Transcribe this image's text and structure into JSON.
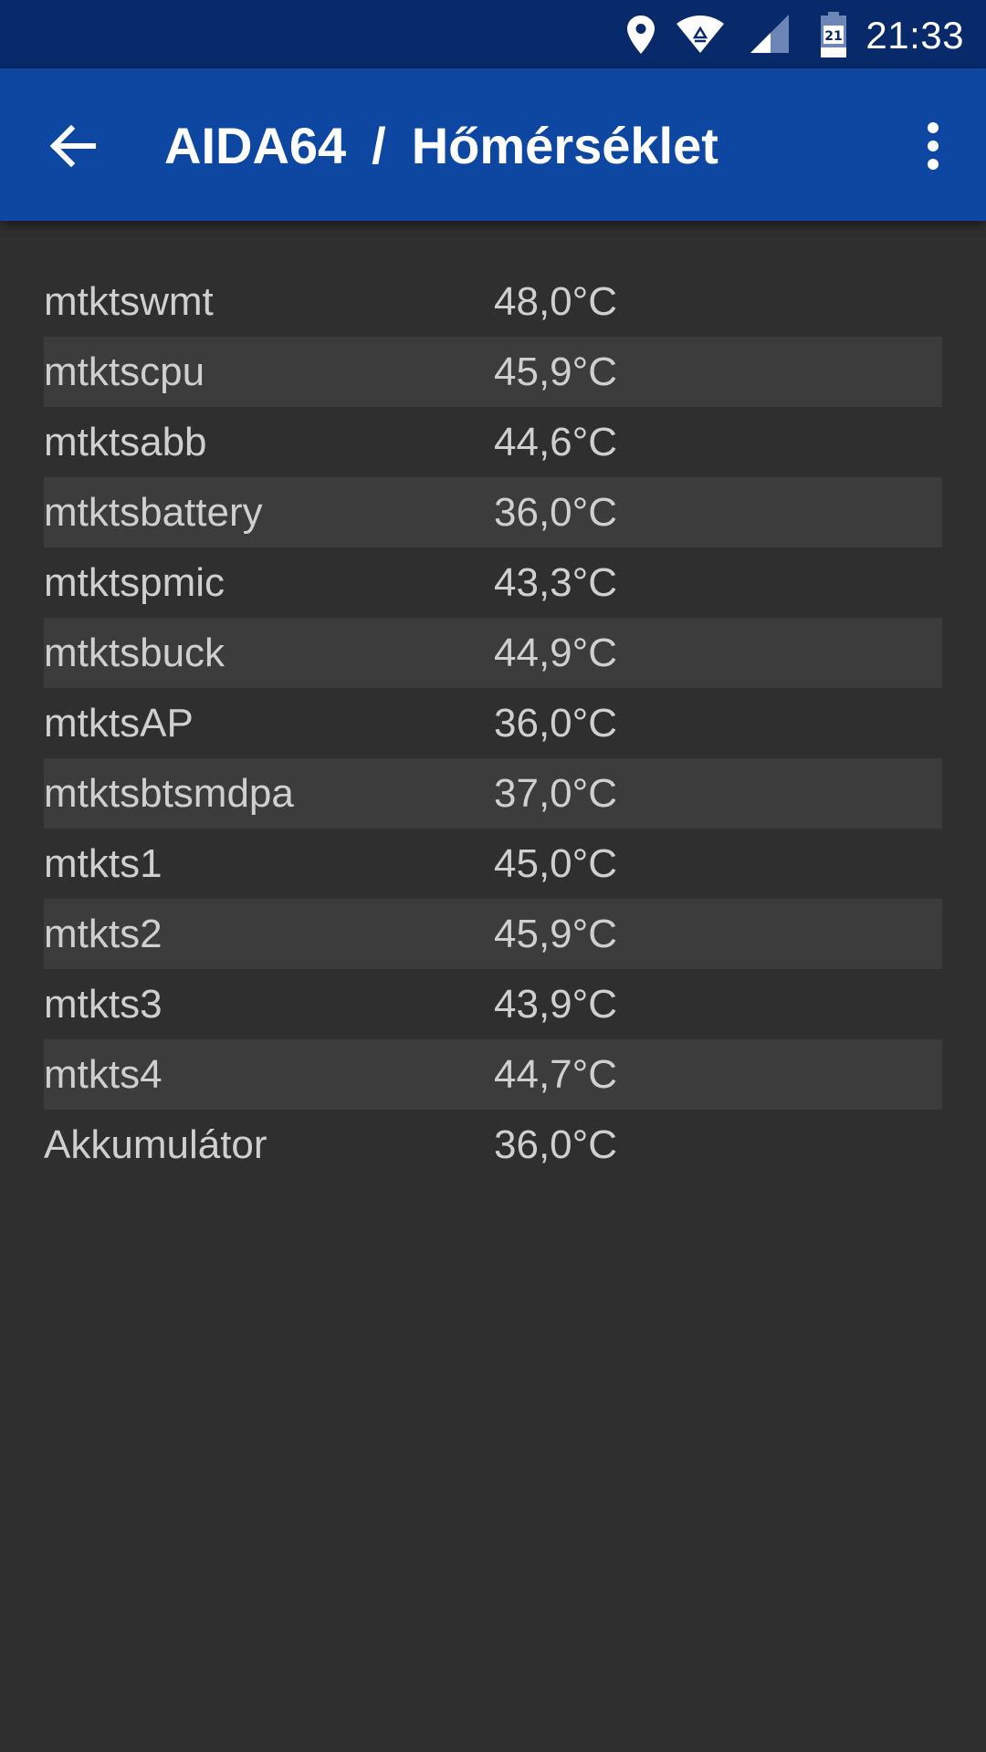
{
  "status_bar": {
    "time": "21:33",
    "battery_level_text": "21",
    "icons": [
      "location-icon",
      "wifi-icon",
      "cell-signal-icon",
      "battery-icon"
    ]
  },
  "app_bar": {
    "app_name": "AIDA64",
    "separator": "/",
    "page_title": "Hőmérséklet",
    "back_icon": "arrow-back-icon",
    "menu_icon": "more-vert-icon"
  },
  "sensors": [
    {
      "name": "mtktswmt",
      "value": "48,0°C"
    },
    {
      "name": "mtktscpu",
      "value": "45,9°C"
    },
    {
      "name": "mtktsabb",
      "value": "44,6°C"
    },
    {
      "name": "mtktsbattery",
      "value": "36,0°C"
    },
    {
      "name": "mtktspmic",
      "value": "43,3°C"
    },
    {
      "name": "mtktsbuck",
      "value": "44,9°C"
    },
    {
      "name": "mtktsAP",
      "value": "36,0°C"
    },
    {
      "name": "mtktsbtsmdpa",
      "value": "37,0°C"
    },
    {
      "name": "mtkts1",
      "value": "45,0°C"
    },
    {
      "name": "mtkts2",
      "value": "45,9°C"
    },
    {
      "name": "mtkts3",
      "value": "43,9°C"
    },
    {
      "name": "mtkts4",
      "value": "44,7°C"
    },
    {
      "name": "Akkumulátor",
      "value": "36,0°C"
    }
  ],
  "colors": {
    "status_bar": "#082a6a",
    "app_bar": "#0d47a1",
    "background": "#2f2f2f",
    "alt_row": "#3c3c3c",
    "text": "#cfcfcf"
  }
}
